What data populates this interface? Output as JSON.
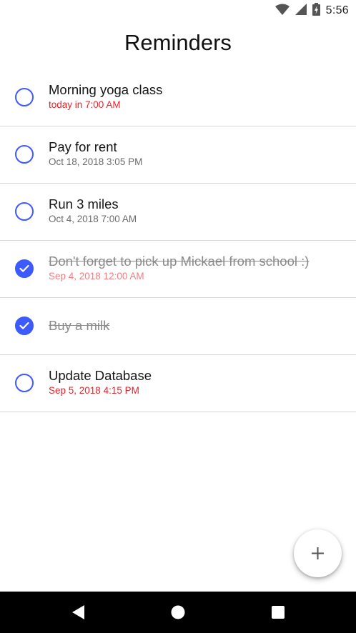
{
  "status_bar": {
    "time": "5:56",
    "icons": [
      "wifi-icon",
      "cell-signal-icon",
      "battery-charging-icon"
    ]
  },
  "header": {
    "title": "Reminders"
  },
  "reminders": [
    {
      "title": "Morning yoga class",
      "date": "today in 7:00 AM",
      "completed": false,
      "date_style": "overdue"
    },
    {
      "title": "Pay for rent",
      "date": "Oct 18, 2018 3:05 PM",
      "completed": false,
      "date_style": "normal"
    },
    {
      "title": "Run 3 miles",
      "date": "Oct 4, 2018 7:00 AM",
      "completed": false,
      "date_style": "normal"
    },
    {
      "title": "Don't forget to pick up Mickael from school :)",
      "date": "Sep 4, 2018 12:00 AM",
      "completed": true,
      "date_style": "overdue-done"
    },
    {
      "title": "Buy a milk",
      "date": "",
      "completed": true,
      "date_style": "none"
    },
    {
      "title": "Update Database",
      "date": "Sep 5, 2018 4:15 PM",
      "completed": false,
      "date_style": "overdue"
    }
  ],
  "fab": {
    "icon": "plus-icon"
  },
  "nav_bar": {
    "icons": [
      "back-icon",
      "home-icon",
      "recents-icon"
    ]
  },
  "colors": {
    "accent": "#3d5afe",
    "overdue": "#e8232a",
    "overdue_done": "#f27c7f",
    "date_gray": "#6b6b6b",
    "nav_bg": "#000000"
  }
}
